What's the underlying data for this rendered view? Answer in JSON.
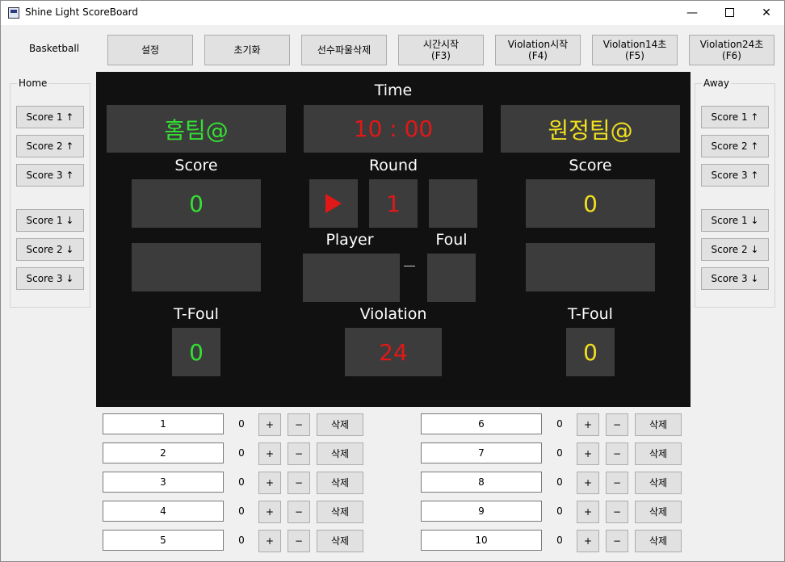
{
  "window": {
    "title": "Shine Light ScoreBoard",
    "min": "—",
    "close": "✕"
  },
  "sport": "Basketball",
  "toolbar": [
    {
      "label": "설정",
      "sub": ""
    },
    {
      "label": "초기화",
      "sub": ""
    },
    {
      "label": "선수파울삭제",
      "sub": ""
    },
    {
      "label": "시간시작",
      "sub": "(F3)"
    },
    {
      "label": "Violation시작",
      "sub": "(F4)"
    },
    {
      "label": "Violation14초",
      "sub": "(F5)"
    },
    {
      "label": "Violation24초",
      "sub": "(F6)"
    }
  ],
  "home_panel": {
    "title": "Home",
    "buttons": [
      "Score 1 ↑",
      "Score 2 ↑",
      "Score 3 ↑",
      "Score 1 ↓",
      "Score 2 ↓",
      "Score 3 ↓"
    ]
  },
  "away_panel": {
    "title": "Away",
    "buttons": [
      "Score 1 ↑",
      "Score 2 ↑",
      "Score 3 ↑",
      "Score 1 ↓",
      "Score 2 ↓",
      "Score 3 ↓"
    ]
  },
  "board": {
    "time_label": "Time",
    "home_name": "홈팀@",
    "away_name": "원정팀@",
    "time": "10 : 00",
    "score_label_home": "Score",
    "score_label_away": "Score",
    "round_label": "Round",
    "home_score": "0",
    "away_score": "0",
    "round": "1",
    "player_label": "Player",
    "foul_label": "Foul",
    "tfoul_label_home": "T-Foul",
    "tfoul_label_away": "T-Foul",
    "violation_label": "Violation",
    "home_tfoul": "0",
    "away_tfoul": "0",
    "violation": "24",
    "colors": {
      "home": "#33e033",
      "away": "#f0e020",
      "time": "#e01818"
    }
  },
  "players": {
    "plus": "+",
    "minus": "−",
    "delete": "삭제",
    "left": [
      {
        "name": "1",
        "fouls": "0"
      },
      {
        "name": "2",
        "fouls": "0"
      },
      {
        "name": "3",
        "fouls": "0"
      },
      {
        "name": "4",
        "fouls": "0"
      },
      {
        "name": "5",
        "fouls": "0"
      }
    ],
    "right": [
      {
        "name": "6",
        "fouls": "0"
      },
      {
        "name": "7",
        "fouls": "0"
      },
      {
        "name": "8",
        "fouls": "0"
      },
      {
        "name": "9",
        "fouls": "0"
      },
      {
        "name": "10",
        "fouls": "0"
      }
    ]
  }
}
